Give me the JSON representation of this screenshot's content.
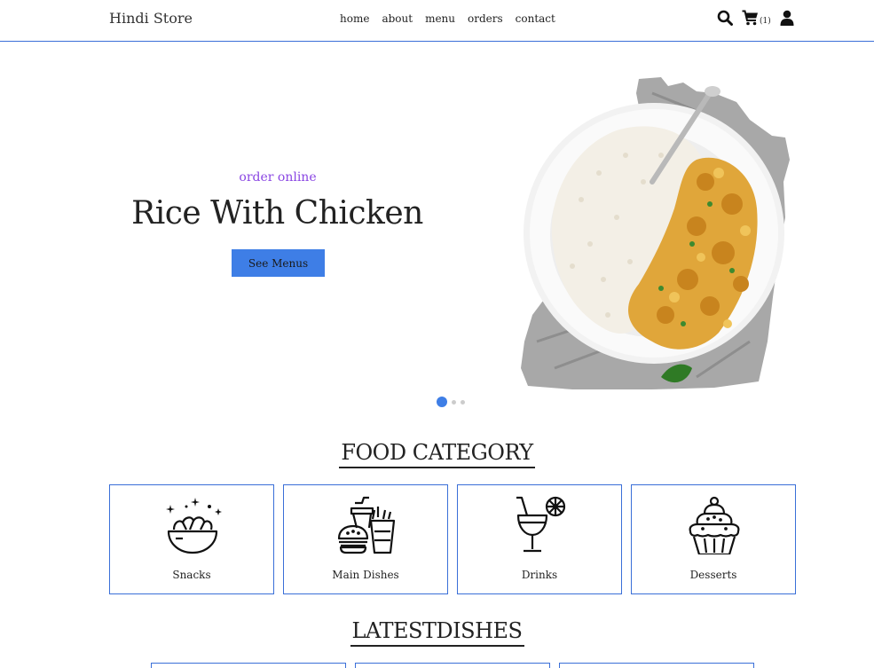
{
  "nav": {
    "brand": "Hindi Store",
    "links": [
      "home",
      "about",
      "menu",
      "orders",
      "contact"
    ],
    "cart_count": "(1)",
    "icons": [
      "search-icon",
      "cart-icon",
      "user-icon"
    ]
  },
  "hero": {
    "subtitle": "order online",
    "title": "Rice With Chicken",
    "button_label": "See Menus",
    "image": "rice-with-chicken-plate",
    "slides_total": 3,
    "active_slide": 1
  },
  "food_category": {
    "title": "FOOD CATEGORY",
    "items": [
      {
        "label": "Snacks",
        "icon": "snack-bowl-icon"
      },
      {
        "label": "Main Dishes",
        "icon": "burger-fries-icon"
      },
      {
        "label": "Drinks",
        "icon": "cocktail-icon"
      },
      {
        "label": "Desserts",
        "icon": "cupcake-icon"
      }
    ]
  },
  "latest_dishes": {
    "title": "LATESTDISHES"
  },
  "colors": {
    "accent": "#3e7ee6",
    "border": "#3a6fd8",
    "subtitle": "#8a46e3"
  }
}
